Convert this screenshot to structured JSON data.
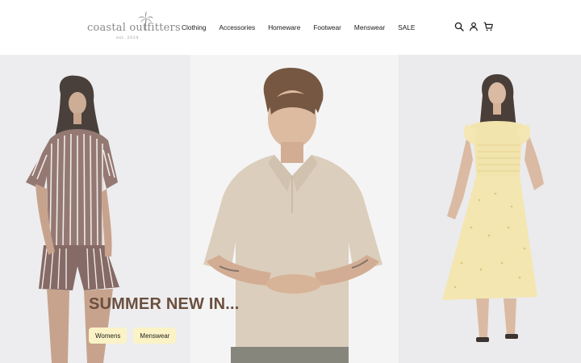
{
  "logo": {
    "name": "coastal outfitters",
    "tagline": "est. 2024"
  },
  "nav": {
    "items": [
      {
        "label": "Clothing"
      },
      {
        "label": "Accessories"
      },
      {
        "label": "Homeware"
      },
      {
        "label": "Footwear"
      },
      {
        "label": "Menswear"
      },
      {
        "label": "SALE"
      }
    ]
  },
  "header_icons": [
    "search-icon",
    "user-icon",
    "cart-icon"
  ],
  "hero": {
    "title": "SUMMER NEW IN...",
    "buttons": [
      {
        "label": "Womens"
      },
      {
        "label": "Menswear"
      }
    ]
  },
  "colors": {
    "title": "#6b4f3f",
    "pill_bg": "#fbf3c6",
    "logo": "#8a8a8a"
  }
}
